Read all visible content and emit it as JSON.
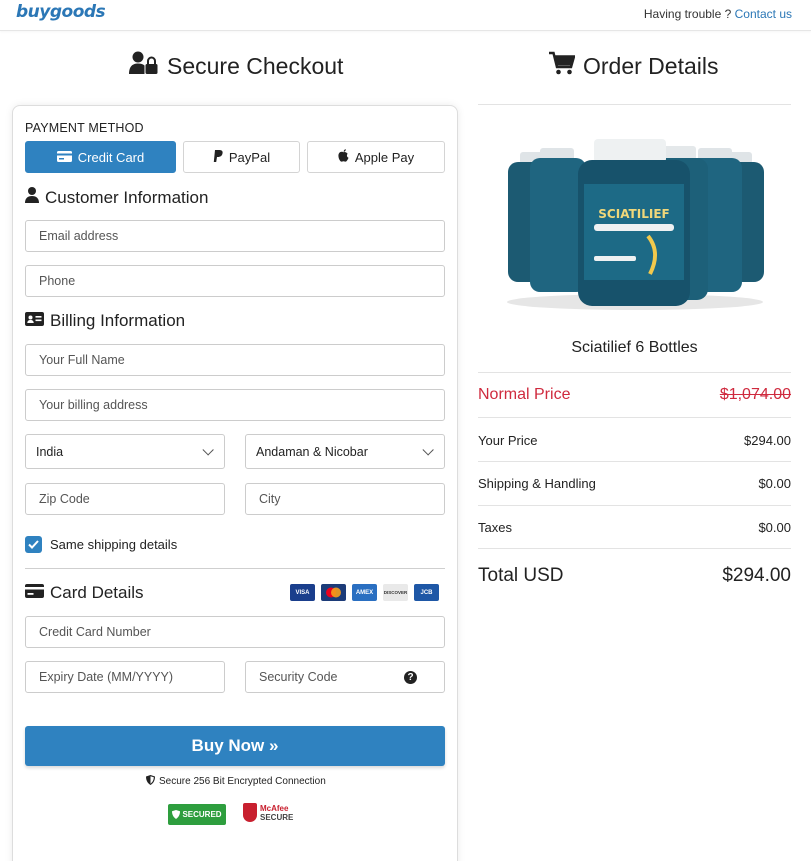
{
  "header": {
    "logo": "buygoods",
    "help_text": "Having trouble ?",
    "contact_link": "Contact us"
  },
  "checkout": {
    "title": "Secure Checkout",
    "payment_method_label": "PAYMENT METHOD",
    "methods": [
      {
        "label": "Credit Card",
        "active": true
      },
      {
        "label": "PayPal",
        "active": false
      },
      {
        "label": "Apple Pay",
        "active": false
      }
    ],
    "customer_title": "Customer Information",
    "email_placeholder": "Email address",
    "phone_placeholder": "Phone",
    "billing_title": "Billing Information",
    "full_name_placeholder": "Your Full Name",
    "address_placeholder": "Your billing address",
    "country_value": "India",
    "state_value": "Andaman & Nicobar",
    "zip_placeholder": "Zip Code",
    "city_placeholder": "City",
    "same_shipping_label": "Same shipping details",
    "same_shipping_checked": true,
    "card_title": "Card Details",
    "card_brands": [
      "VISA",
      "MC",
      "AMEX",
      "DISCOVER",
      "JCB"
    ],
    "card_number_placeholder": "Credit Card Number",
    "expiry_placeholder": "Expiry Date (MM/YYYY)",
    "security_placeholder": "Security Code",
    "buy_button": "Buy Now »",
    "secure_note": "Secure 256 Bit Encrypted Connection",
    "badge_secured": "SECURED",
    "badge_mcafee_top": "McAfee",
    "badge_mcafee_bottom": "SECURE"
  },
  "order": {
    "title": "Order Details",
    "product_name": "Sciatilief 6 Bottles",
    "bottle_label": "SCIATILIEF",
    "normal_price_label": "Normal Price",
    "normal_price_value": "$1,074.00",
    "your_price_label": "Your Price",
    "your_price_value": "$294.00",
    "shipping_label": "Shipping & Handling",
    "shipping_value": "$0.00",
    "taxes_label": "Taxes",
    "taxes_value": "$0.00",
    "total_label": "Total USD",
    "total_value": "$294.00"
  },
  "colors": {
    "accent": "#2f82c0",
    "strike_red": "#cf2a3e",
    "bottle_teal": "#1c5a72"
  }
}
